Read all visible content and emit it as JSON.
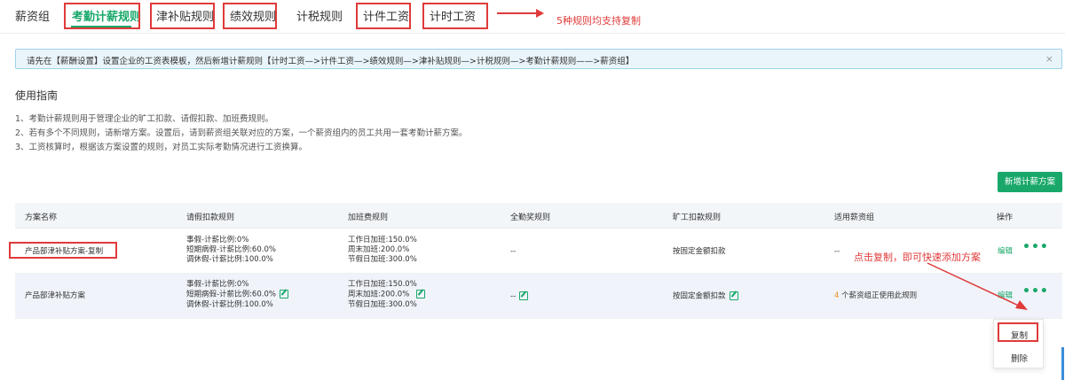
{
  "tabs": [
    {
      "label": "薪资组"
    },
    {
      "label": "考勤计薪规则"
    },
    {
      "label": "津补贴规则"
    },
    {
      "label": "绩效规则"
    },
    {
      "label": "计税规则"
    },
    {
      "label": "计件工资"
    },
    {
      "label": "计时工资"
    }
  ],
  "annotations": {
    "tabs_note": "5种规则均支持复制",
    "copy_note": "点击复制，即可快速添加方案"
  },
  "notice": {
    "text": "请先在【薪酬设置】设置企业的工资表模板，然后新增计薪规则【计时工资—>计件工资—>绩效规则—>津补贴规则—>计税规则—>考勤计薪规则——>薪资组】",
    "close": "×"
  },
  "guide": {
    "title": "使用指南",
    "lines": [
      "1、考勤计薪规则用于管理企业的旷工扣款、请假扣款、加班费规则。",
      "2、若有多个不同规则，请新增方案。设置后，请到薪资组关联对应的方案，一个薪资组内的员工共用一套考勤计薪方案。",
      "3、工资核算时，根据该方案设置的规则，对员工实际考勤情况进行工资换算。"
    ]
  },
  "add_button": "新增计薪方案",
  "table": {
    "headers": [
      "方案名称",
      "请假扣款规则",
      "加班费规则",
      "全勤奖规则",
      "旷工扣款规则",
      "适用薪资组",
      "操作"
    ],
    "rows": [
      {
        "name": "产品部津补贴方案-复制",
        "leave": [
          "事假-计薪比例:0%",
          "短期病假-计薪比例:60.0%",
          "调休假-计薪比例:100.0%"
        ],
        "overtime": [
          "工作日加班:150.0%",
          "周末加班:200.0%",
          "节假日加班:300.0%"
        ],
        "attendance": "--",
        "absence": "按固定金额扣款",
        "groups": "--",
        "edit": "编辑",
        "more": "•••"
      },
      {
        "name": "产品部津补贴方案",
        "leave": [
          "事假-计薪比例:0%",
          "短期病假-计薪比例:60.0%",
          "调休假-计薪比例:100.0%"
        ],
        "overtime": [
          "工作日加班:150.0%",
          "周末加班:200.0%",
          "节假日加班:300.0%"
        ],
        "attendance": "--",
        "absence": "按固定金额扣款",
        "groups_count": "4",
        "groups_text": "个薪资组正使用此规则",
        "edit": "编辑",
        "more": "•••"
      }
    ]
  },
  "dropdown": {
    "items": [
      "复制",
      "删除"
    ]
  },
  "colors": {
    "accent": "#19a86a",
    "annotation": "#e03a3a",
    "warning": "#f08a1c"
  }
}
